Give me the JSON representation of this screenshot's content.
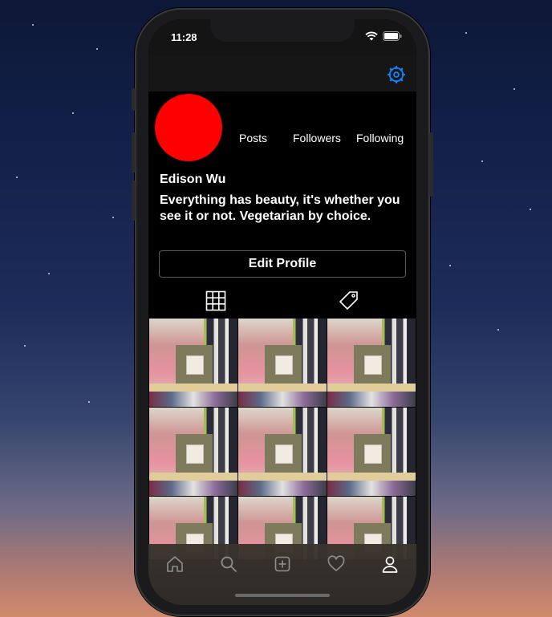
{
  "status_bar": {
    "time": "11:28",
    "icons": [
      "wifi-icon",
      "battery-icon"
    ]
  },
  "nav": {
    "settings_icon": "gear-icon",
    "accent_color": "#0a84ff"
  },
  "profile": {
    "avatar_color": "#ff0000",
    "stats": [
      "Posts",
      "Followers",
      "Following"
    ],
    "name": "Edison Wu",
    "bio": "Everything has beauty, it's whether you see it or not. Vegetarian by choice.",
    "edit_button": "Edit Profile"
  },
  "content_tabs": [
    "grid-icon",
    "tag-icon"
  ],
  "posts_grid": {
    "visible_items": 9
  },
  "tab_bar": [
    "home-icon",
    "search-icon",
    "add-post-icon",
    "heart-icon",
    "profile-icon"
  ]
}
